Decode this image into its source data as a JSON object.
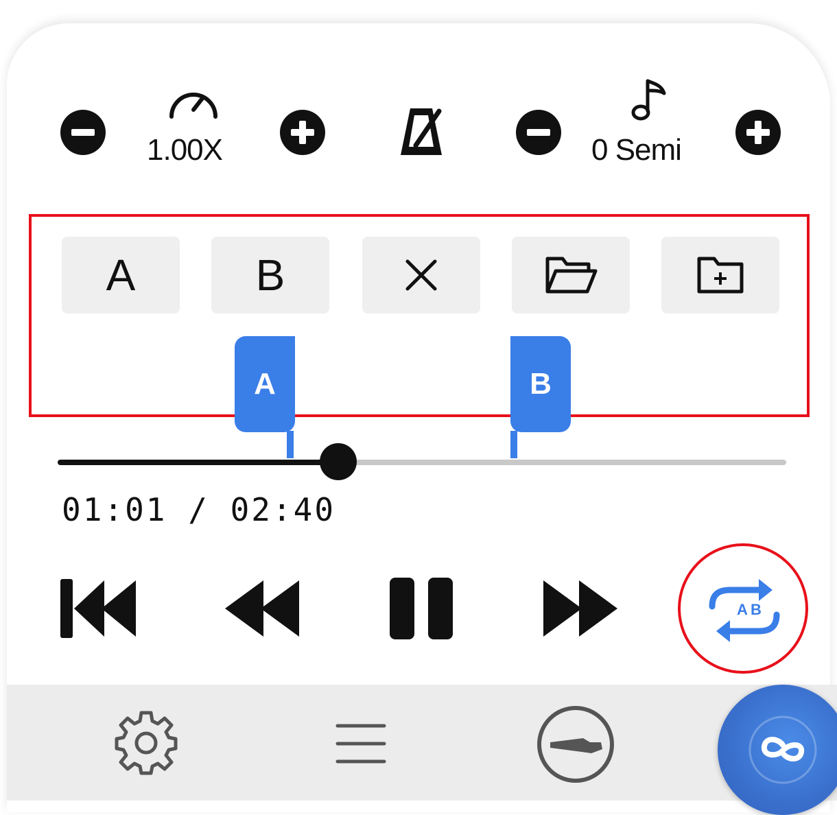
{
  "speed": {
    "value": "1.00X"
  },
  "pitch": {
    "value": "0 Semi"
  },
  "ab_buttons": [
    {
      "label": "A"
    },
    {
      "label": "B"
    }
  ],
  "markers": {
    "a_label": "A",
    "b_label": "B"
  },
  "playback": {
    "current": "01:01",
    "separator": "/",
    "total": "02:40",
    "progress_fraction": 0.38
  },
  "loop_icon_labels": {
    "a": "A",
    "b": "B"
  },
  "icons": {
    "speed_minus": "minus-circle-icon",
    "speed": "speedometer-icon",
    "speed_plus": "plus-circle-icon",
    "metronome": "metronome-icon",
    "pitch_minus": "minus-circle-icon",
    "pitch": "music-note-icon",
    "pitch_plus": "plus-circle-icon",
    "clear": "close-icon",
    "open": "folder-open-icon",
    "save": "folder-add-icon",
    "skip_back": "skip-previous-icon",
    "rewind": "rewind-icon",
    "pause": "pause-icon",
    "forward": "fast-forward-icon",
    "ab_loop": "ab-repeat-icon",
    "settings": "gear-icon",
    "menu": "menu-icon",
    "instrument": "guitar-icon",
    "infinity": "infinity-icon"
  },
  "colors": {
    "accent": "#3a7ee8",
    "highlight": "#e8101a",
    "fab": "#3a6fcc"
  }
}
